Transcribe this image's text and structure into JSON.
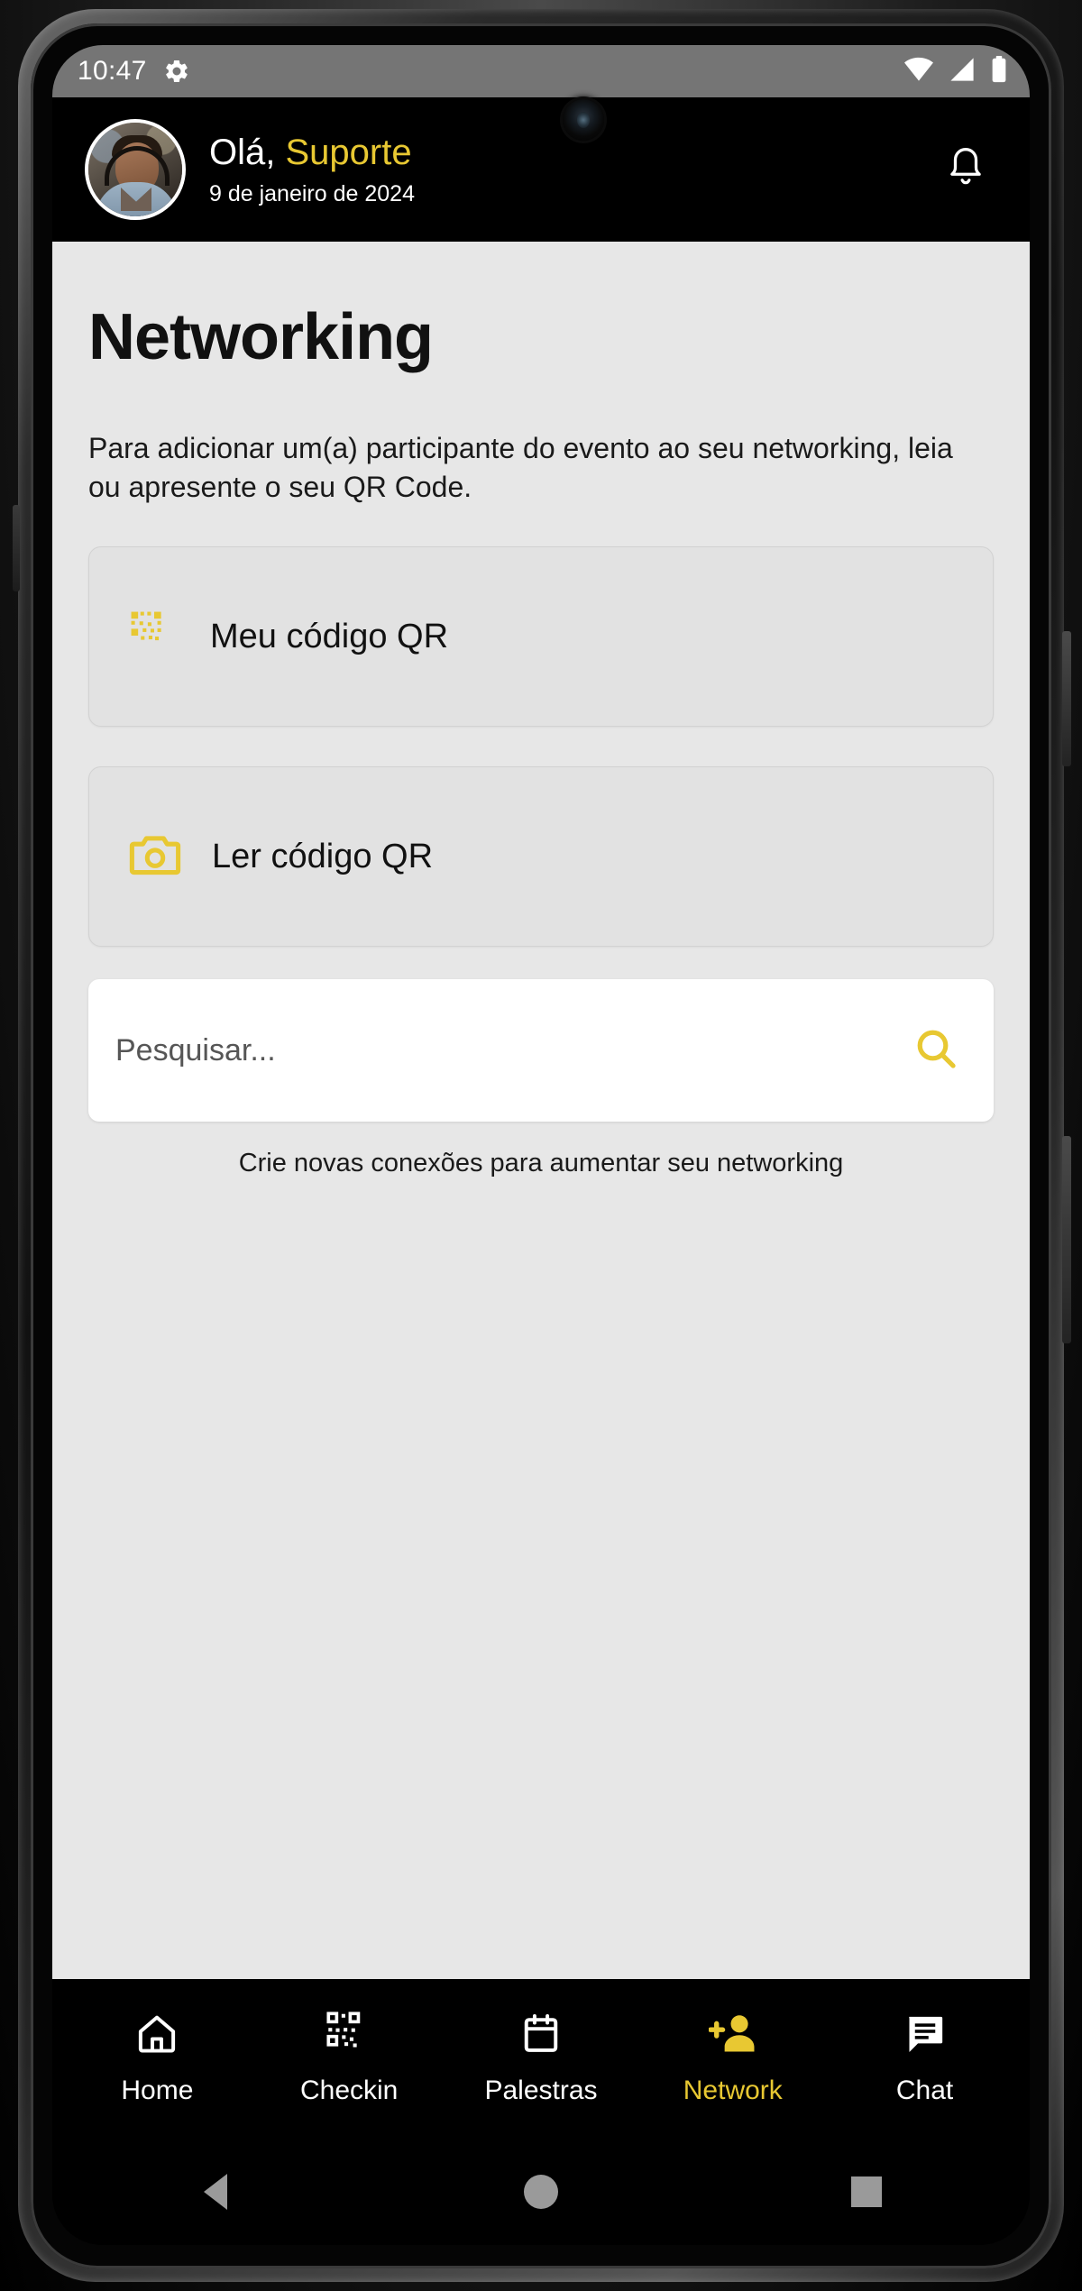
{
  "status_bar": {
    "time": "10:47",
    "icons": [
      "gear-icon",
      "wifi-icon",
      "cellular-signal-icon",
      "battery-icon"
    ]
  },
  "header": {
    "greeting_prefix": "Olá, ",
    "user_name": "Suporte",
    "date": "9 de janeiro de 2024",
    "avatar_alt": "user-avatar",
    "notification_icon": "bell-icon"
  },
  "main": {
    "page_title": "Networking",
    "description": "Para adicionar um(a) participante do evento ao seu networking, leia ou apresente o seu QR Code.",
    "actions": [
      {
        "icon": "qr-code-icon",
        "label": "Meu código QR"
      },
      {
        "icon": "camera-icon",
        "label": "Ler código QR"
      }
    ],
    "search": {
      "placeholder": "Pesquisar...",
      "value": "",
      "icon": "search-icon"
    },
    "hint": "Crie novas conexões para aumentar seu networking"
  },
  "bottom_nav": {
    "items": [
      {
        "label": "Home",
        "icon": "home-icon",
        "active": false
      },
      {
        "label": "Checkin",
        "icon": "qr-scan-icon",
        "active": false
      },
      {
        "label": "Palestras",
        "icon": "calendar-icon",
        "active": false
      },
      {
        "label": "Network",
        "icon": "add-person-icon",
        "active": true
      },
      {
        "label": "Chat",
        "icon": "chat-bubble-icon",
        "active": false
      }
    ]
  },
  "android_nav": {
    "back": "back-triangle-icon",
    "home": "home-circle-icon",
    "recents": "recents-square-icon"
  },
  "colors": {
    "accent": "#E8C832",
    "background": "#E7E7E7",
    "card": "#E2E2E2",
    "header": "#000000",
    "status_bar": "#757575"
  }
}
